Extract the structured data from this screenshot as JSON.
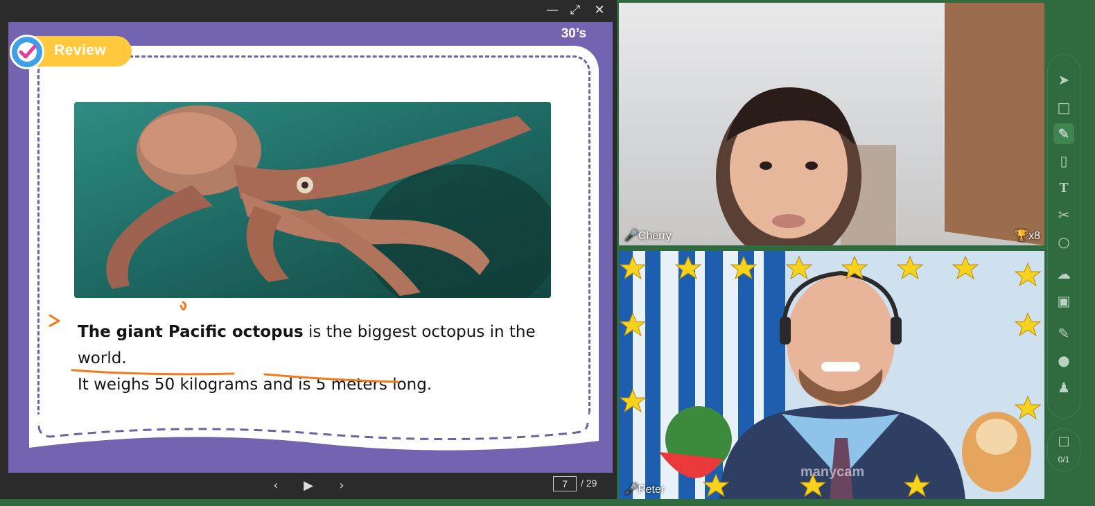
{
  "window": {
    "minimize_icon": "minimize-icon",
    "restore_icon": "restore-icon",
    "close_icon": "close-icon"
  },
  "slide": {
    "timer": "30’s",
    "badge_label": "Review",
    "badge_icon": "checkmark-icon",
    "image_subject": "giant-pacific-octopus-photo",
    "text_bold": "The giant Pacific octopus",
    "text_line1_rest": " is the biggest octopus in the world.",
    "text_line2": "It weighs 50 kilograms and is 5 meters long.",
    "annotation_color": "#f27a1a",
    "background_color": "#7463b0"
  },
  "pager": {
    "prev_icon": "chevron-left-icon",
    "play_icon": "play-icon",
    "next_icon": "chevron-right-icon",
    "current_page": "7",
    "total_pages": "/ 29"
  },
  "videos": [
    {
      "name": "Cherry",
      "mic_icon": "microphone-icon",
      "trophy_icon": "trophy-icon",
      "trophies": "x8"
    },
    {
      "name": "Peter",
      "mic_icon": "microphone-icon",
      "watermark": "manycam"
    }
  ],
  "toolbar": {
    "tools": [
      "select-arrow-icon",
      "area-select-icon",
      "pen-icon",
      "eraser-icon",
      "text-icon",
      "scissors-icon",
      "laser-pointer-icon",
      "cloud-icon",
      "toolbox-icon",
      "edit-note-icon",
      "chat-icon",
      "users-icon"
    ],
    "active_tool": "pen-icon"
  },
  "counter": {
    "icon": "seat-icon",
    "value": "0/1"
  }
}
